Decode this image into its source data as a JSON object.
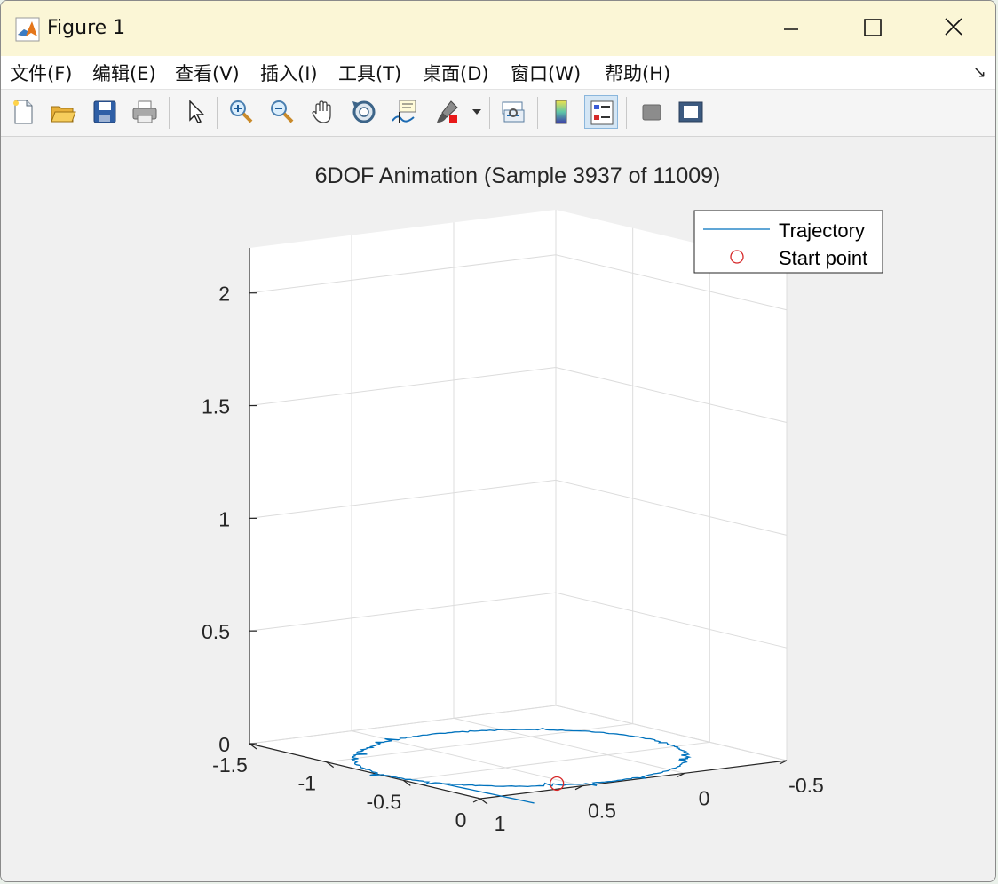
{
  "window": {
    "title": "Figure 1"
  },
  "menu": [
    "文件(F)",
    "编辑(E)",
    "查看(V)",
    "插入(I)",
    "工具(T)",
    "桌面(D)",
    "窗口(W)",
    "帮助(H)"
  ],
  "toolbar": [
    {
      "name": "new-figure-icon"
    },
    {
      "name": "open-file-icon"
    },
    {
      "name": "save-icon"
    },
    {
      "name": "print-icon"
    },
    {
      "name": "edit-plot-arrow-icon"
    },
    {
      "name": "zoom-in-icon"
    },
    {
      "name": "zoom-out-icon"
    },
    {
      "name": "pan-hand-icon"
    },
    {
      "name": "rotate-3d-icon"
    },
    {
      "name": "data-cursor-icon"
    },
    {
      "name": "brush-icon"
    },
    {
      "name": "brush-dropdown-icon"
    },
    {
      "name": "link-plot-icon"
    },
    {
      "name": "insert-colorbar-icon"
    },
    {
      "name": "insert-legend-icon"
    },
    {
      "name": "hide-plot-tools-icon"
    },
    {
      "name": "show-plot-tools-icon"
    }
  ],
  "colors": {
    "trajectory": "#0072bd",
    "start_point": "#d62728",
    "titlebar": "#fbf6d6"
  },
  "chart_data": {
    "type": "line3d",
    "title": "6DOF Animation (Sample 3937 of 11009)",
    "xlim": [
      -1.5,
      0
    ],
    "ylim": [
      -0.5,
      1
    ],
    "zlim": [
      0,
      2.2
    ],
    "xticks": [
      "-1.5",
      "-1",
      "-0.5",
      "0"
    ],
    "yticks": [
      "1",
      "0.5",
      "0",
      "-0.5"
    ],
    "zticks": [
      "0",
      "0.5",
      "1",
      "1.5",
      "2"
    ],
    "grid": true,
    "legend": {
      "position": "top-right",
      "entries": [
        "Trajectory",
        "Start point"
      ]
    },
    "series": [
      {
        "name": "Trajectory",
        "type": "line",
        "shape": "near-circular loop of radius ~0.6 centered at (-0.6, 0.35) on the plane z≈0, with small jitter, exiting toward y=-0.5"
      },
      {
        "name": "Start point",
        "type": "marker",
        "marker": "circle",
        "x": -0.1,
        "y": 0.55,
        "z": 0
      }
    ]
  }
}
